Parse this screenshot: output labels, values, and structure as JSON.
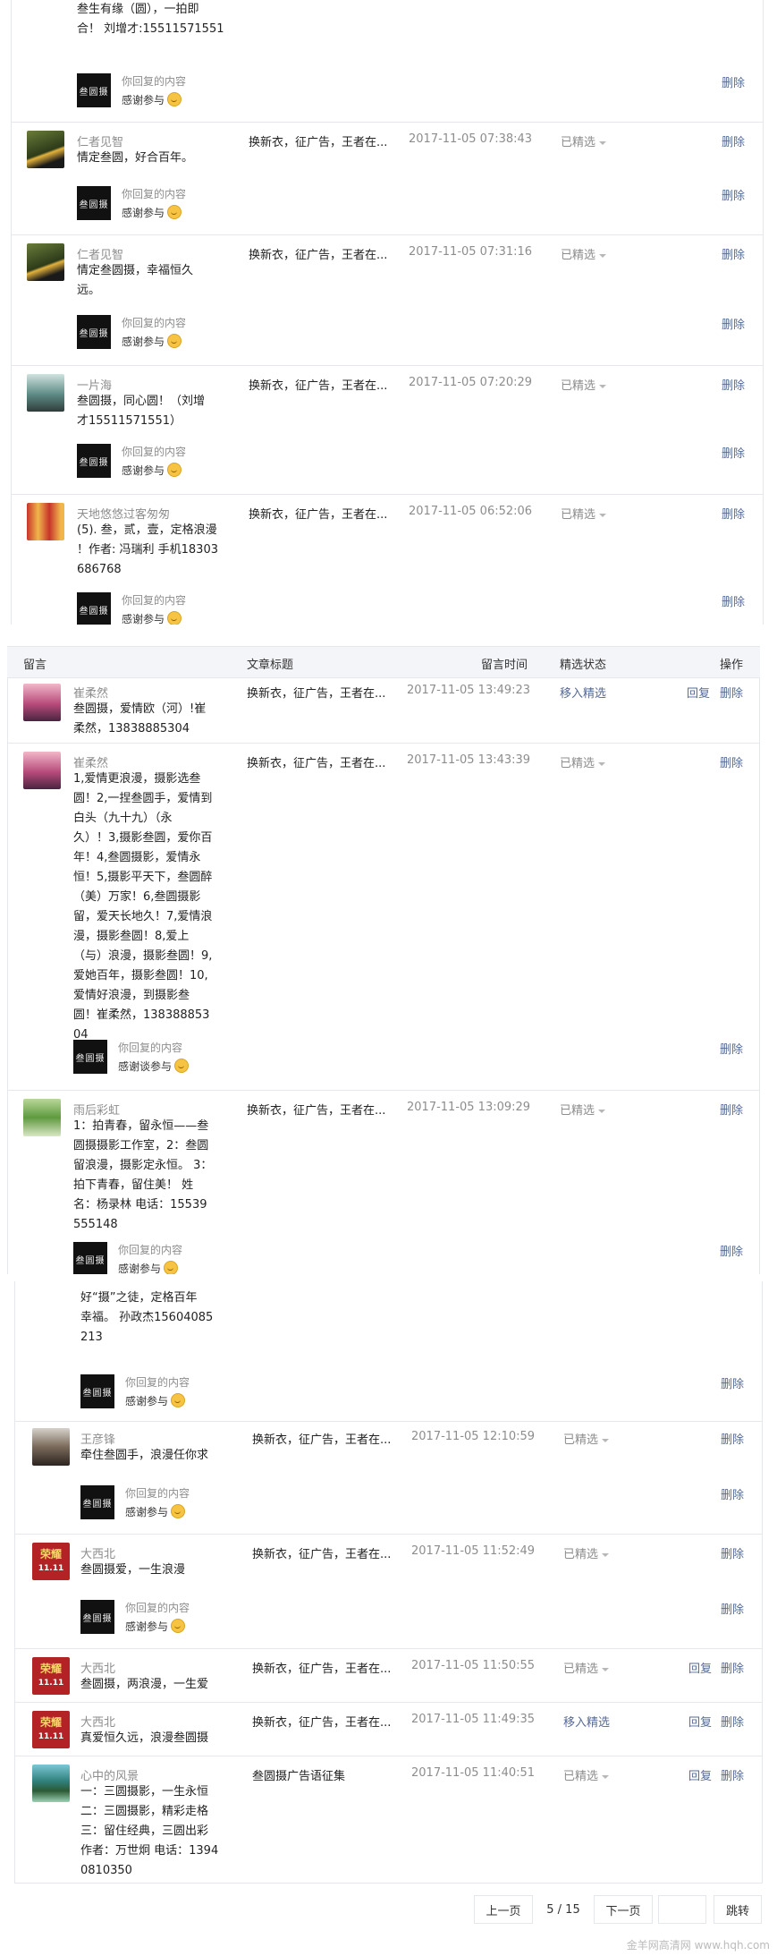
{
  "header": {
    "col_comment": "留言",
    "col_article": "文章标题",
    "col_time": "留言时间",
    "col_status": "精选状态",
    "col_ops": "操作"
  },
  "labels": {
    "delete": "删除",
    "reply": "回复",
    "your_reply": "你回复的内容",
    "featured": "已精选",
    "move_to_featured": "移入精选"
  },
  "seg1": {
    "top_msg": "叁生有缘（圆），一拍即\n合！ 刘增才:15511571551",
    "top_reply": "感谢参与",
    "rows": [
      {
        "name": "仁者见智",
        "msg": "情定叁圆，好合百年。",
        "title": "换新衣，征广告，王者在...",
        "time": "2017-11-05 07:38:43",
        "reply": "感谢参与"
      },
      {
        "name": "仁者见智",
        "msg": "情定叁圆摄，幸福恒久\n远。",
        "title": "换新衣，征广告，王者在...",
        "time": "2017-11-05 07:31:16",
        "reply": "感谢参与"
      },
      {
        "name": "一片海",
        "msg": "叁圆摄，同心圆！（刘增\n才15511571551）",
        "title": "换新衣，征广告，王者在...",
        "time": "2017-11-05 07:20:29",
        "reply": "感谢参与"
      },
      {
        "name": "天地悠悠过客匆匆",
        "msg": "(5). 叁，贰，壹，定格浪漫\n！作者: 冯瑞利 手机18303\n686768",
        "title": "换新衣，征广告，王者在...",
        "time": "2017-11-05 06:52:06",
        "reply": "感谢参与"
      }
    ]
  },
  "seg2": {
    "rows": [
      {
        "name": "崔柔然",
        "msg": "叁圆摄，爱情欧（河）!崔\n柔然，13838885304",
        "title": "换新衣，征广告，王者在...",
        "time": "2017-11-05 13:49:23"
      },
      {
        "name": "崔柔然",
        "msg": "1,爱情更浪漫，摄影选叁\n圆！2,一捏叁圆手，爱情到\n白头（九十九）（永\n久）！3,摄影叁圆，爱你百\n年！4,叁圆摄影，爱情永\n恒！5,摄影平天下，叁圆醉\n（美）万家！6,叁圆摄影\n留，爱天长地久！7,爱情浪\n漫，摄影叁圆！8,爱上\n（与）浪漫，摄影叁圆！9,\n爱她百年，摄影叁圆！10,\n爱情好浪漫，到摄影叁\n圆！崔柔然，138388853\n04",
        "title": "换新衣，征广告，王者在...",
        "time": "2017-11-05 13:43:39",
        "reply": "感谢谈参与"
      },
      {
        "name": "雨后彩虹",
        "msg": "1：拍青春，留永恒——叁\n圆摄摄影工作室，2：叁圆\n留浪漫，摄影定永恒。 3：\n拍下青春，留住美！ 姓\n名：杨录林 电话：15539\n555148",
        "title": "换新衣，征广告，王者在...",
        "time": "2017-11-05 13:09:29",
        "reply": "感谢参与"
      }
    ]
  },
  "seg3": {
    "top_msg": "好“摄”之徒，定格百年\n幸福。 孙政杰15604085\n213",
    "top_reply": "感谢参与",
    "rows": [
      {
        "name": "王彦锋",
        "msg": "牵住叁圆手，浪漫任你求",
        "title": "换新衣，征广告，王者在...",
        "time": "2017-11-05 12:10:59",
        "reply": "感谢参与"
      },
      {
        "name": "大西北",
        "msg": "叁圆摄爱，一生浪漫",
        "title": "换新衣，征广告，王者在...",
        "time": "2017-11-05 11:52:49",
        "reply": "感谢参与"
      },
      {
        "name": "大西北",
        "msg": "叁圆摄，两浪漫，一生爱",
        "title": "换新衣，征广告，王者在...",
        "time": "2017-11-05 11:50:55"
      },
      {
        "name": "大西北",
        "msg": "真爱恒久远，浪漫叁圆摄",
        "title": "换新衣，征广告，王者在...",
        "time": "2017-11-05 11:49:35"
      },
      {
        "name": "心中的风景",
        "msg": "一：三圆摄影，一生永恒\n二：三圆摄影，精彩走格\n三：留住经典，三圆出彩\n作者：万世炯 电话：1394\n0810350",
        "title": "叁圆摄广告语征集",
        "time": "2017-11-05 11:40:51"
      }
    ]
  },
  "avatar_text": "叁圆摄",
  "honor_text": "荣耀",
  "honor_sub": "11.11",
  "pagination": {
    "prev": "上一页",
    "page": "5 / 15",
    "next": "下一页",
    "jump": "跳转"
  },
  "watermark": "金羊网高清网 www.hqh.com",
  "colors": {
    "link": "#576b95",
    "muted": "#8d8d8d",
    "border": "#e7e7eb",
    "header_bg": "#f4f5f9"
  }
}
